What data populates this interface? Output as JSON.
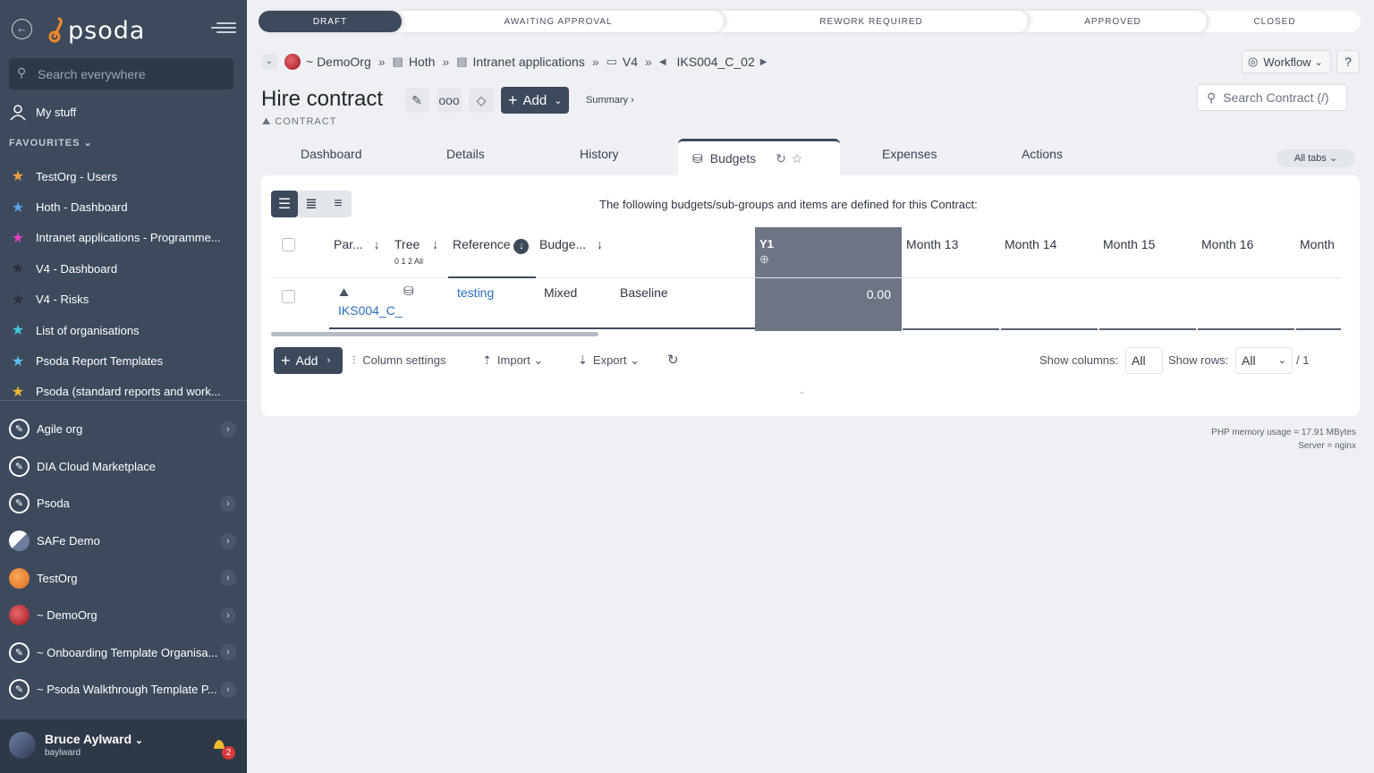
{
  "sidebar": {
    "logo": "psoda",
    "search_placeholder": "Search everywhere",
    "my_stuff": "My stuff",
    "favourites_label": "FAVOURITES",
    "favourites": [
      {
        "label": "TestOrg - Users",
        "color": "#f0a040"
      },
      {
        "label": "Hoth - Dashboard",
        "color": "#5aa0e8"
      },
      {
        "label": "Intranet applications - Programme...",
        "color": "#e040c0"
      },
      {
        "label": "V4 - Dashboard",
        "color": "#2a2f38"
      },
      {
        "label": "V4 - Risks",
        "color": "#2a2f38"
      },
      {
        "label": "List of organisations",
        "color": "#40c8e0"
      },
      {
        "label": "Psoda Report Templates",
        "color": "#5ac0f0"
      },
      {
        "label": "Psoda (standard reports and work...",
        "color": "#f0b830"
      }
    ],
    "orgs": [
      {
        "label": "Agile org",
        "icon": "pen",
        "chevron": true
      },
      {
        "label": "DIA Cloud Marketplace",
        "icon": "pen",
        "chevron": false
      },
      {
        "label": "Psoda",
        "icon": "pen",
        "chevron": true
      },
      {
        "label": "SAFe Demo",
        "icon": "safe",
        "chevron": true
      },
      {
        "label": "TestOrg",
        "icon": "orange",
        "chevron": true
      },
      {
        "label": "~ DemoOrg",
        "icon": "red",
        "chevron": true
      },
      {
        "label": "~ Onboarding Template Organisa...",
        "icon": "pen",
        "chevron": true
      },
      {
        "label": "~ Psoda Walkthrough Template P...",
        "icon": "pen",
        "chevron": true
      }
    ],
    "user": {
      "name": "Bruce Aylward",
      "login": "baylward",
      "notifications": "2"
    }
  },
  "status": {
    "stages": [
      "DRAFT",
      "AWAITING APPROVAL",
      "REWORK REQUIRED",
      "APPROVED",
      "CLOSED"
    ],
    "active": "DRAFT"
  },
  "breadcrumb": {
    "org": "~ DemoOrg",
    "portfolio": "Hoth",
    "programme": "Intranet applications",
    "project": "V4",
    "current": "IKS004_C_02"
  },
  "header": {
    "title": "Hire contract",
    "type": "CONTRACT",
    "add_label": "Add",
    "summary_link": "Summary ›",
    "workflow_label": "Workflow",
    "help_label": "?",
    "search_placeholder": "Search Contract (/)"
  },
  "tabs": {
    "items": [
      "Dashboard",
      "Details",
      "History",
      "Budgets",
      "Expenses",
      "Actions"
    ],
    "active": "Budgets",
    "all_tabs": "All tabs"
  },
  "budgets": {
    "description": "The following budgets/sub-groups and items are defined for this Contract:",
    "columns": [
      "Par...",
      "Tree",
      "Reference",
      "Budge...",
      "Y1",
      "Month 13",
      "Month 14",
      "Month 15",
      "Month 16",
      "Month"
    ],
    "tree_levels": "0 1 2 All",
    "rows": [
      {
        "parent": "IKS004_C_",
        "reference": "testing",
        "type": "Mixed",
        "budget": "Baseline",
        "y1": "0.00"
      }
    ]
  },
  "footer": {
    "add_label": "Add",
    "column_settings": "Column settings",
    "import": "Import",
    "export": "Export",
    "show_columns_label": "Show columns:",
    "show_columns_value": "All",
    "show_rows_label": "Show rows:",
    "show_rows_value": "All",
    "page_total": "/ 1"
  },
  "server_info": {
    "memory": "PHP memory usage = 17.91 MBytes",
    "server": "Server = nginx"
  }
}
